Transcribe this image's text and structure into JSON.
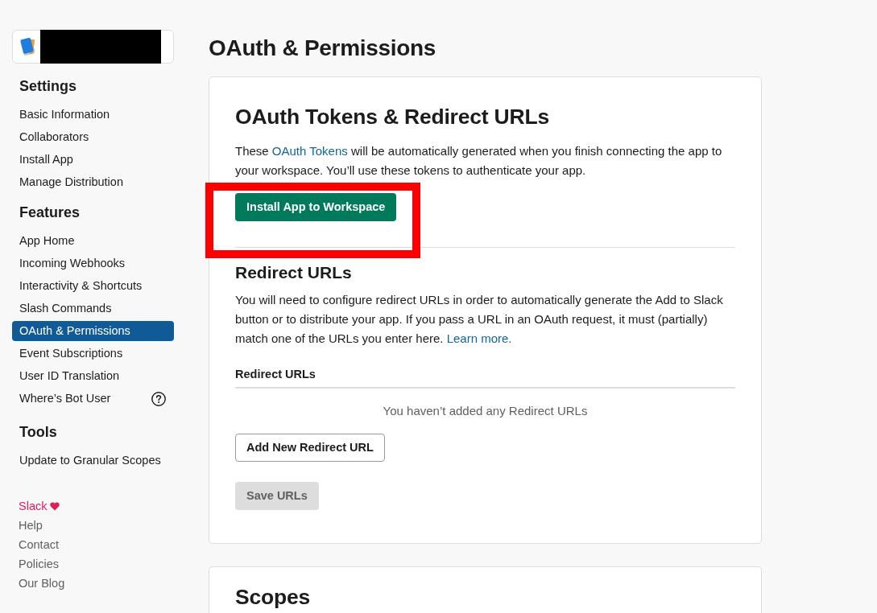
{
  "app": {
    "name_redacted": true
  },
  "sidebar": {
    "sections": [
      {
        "heading": "Settings",
        "items": [
          {
            "label": "Basic Information",
            "kind": "link",
            "selected": false
          },
          {
            "label": "Collaborators",
            "kind": "link",
            "selected": false
          },
          {
            "label": "Install App",
            "kind": "link",
            "selected": false
          },
          {
            "label": "Manage Distribution",
            "kind": "link",
            "selected": false
          }
        ]
      },
      {
        "heading": "Features",
        "items": [
          {
            "label": "App Home",
            "kind": "link",
            "selected": false
          },
          {
            "label": "Incoming Webhooks",
            "kind": "link",
            "selected": false
          },
          {
            "label": "Interactivity & Shortcuts",
            "kind": "link",
            "selected": false
          },
          {
            "label": "Slash Commands",
            "kind": "link",
            "selected": false
          },
          {
            "label": "OAuth & Permissions",
            "kind": "link",
            "selected": true
          },
          {
            "label": "Event Subscriptions",
            "kind": "link",
            "selected": false
          },
          {
            "label": "User ID Translation",
            "kind": "link",
            "selected": false
          },
          {
            "label": "Where’s Bot User",
            "kind": "help",
            "selected": false
          }
        ]
      },
      {
        "heading": "Tools",
        "items": [
          {
            "label": "Update to Granular Scopes",
            "kind": "link",
            "selected": false
          }
        ]
      }
    ],
    "footer_links": [
      {
        "label": "Slack",
        "kind": "brand"
      },
      {
        "label": "Help",
        "kind": "plain"
      },
      {
        "label": "Contact",
        "kind": "plain"
      },
      {
        "label": "Policies",
        "kind": "plain"
      },
      {
        "label": "Our Blog",
        "kind": "plain"
      }
    ]
  },
  "page_title": "OAuth & Permissions",
  "oauth_card": {
    "title": "OAuth Tokens & Redirect URLs",
    "intro": [
      {
        "kind": "text",
        "text": "These "
      },
      {
        "kind": "link",
        "text": "OAuth Tokens"
      },
      {
        "kind": "text",
        "text": " will be automatically generated when you finish connecting the app to your workspace. You’ll use these tokens to authenticate your app."
      }
    ],
    "install_button": {
      "label": "Install App to Workspace",
      "highlighted": true
    },
    "redirect_section": {
      "title": "Redirect URLs",
      "description": [
        {
          "kind": "text",
          "text": "You will need to configure redirect URLs in order to automatically generate the Add to Slack button or to distribute your app. If you pass a URL in an OAuth request, it must (partially) match one of the URLs you enter here. "
        },
        {
          "kind": "link",
          "text": "Learn more."
        }
      ],
      "list_label": "Redirect URLs",
      "empty_message": "You haven’t added any Redirect URLs",
      "add_button": "Add New Redirect URL",
      "save_button": {
        "label": "Save URLs",
        "disabled": true
      }
    }
  },
  "scopes_card": {
    "title": "Scopes"
  }
}
